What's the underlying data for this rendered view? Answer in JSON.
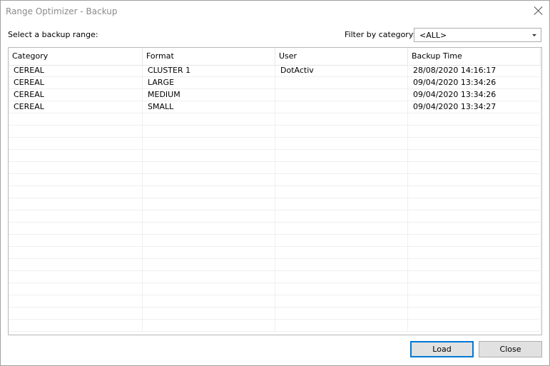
{
  "window": {
    "title": "Range Optimizer - Backup"
  },
  "form": {
    "select_label": "Select a backup range:",
    "filter_label": "Filter by category:",
    "filter_value": "<ALL>"
  },
  "table": {
    "columns": [
      "Category",
      "Format",
      "User",
      "Backup Time"
    ],
    "rows": [
      [
        "CEREAL",
        "CLUSTER 1",
        "DotActiv",
        "28/08/2020 14:16:17"
      ],
      [
        "CEREAL",
        "LARGE",
        "",
        "09/04/2020 13:34:26"
      ],
      [
        "CEREAL",
        "MEDIUM",
        "",
        "09/04/2020 13:34:26"
      ],
      [
        "CEREAL",
        "SMALL",
        "",
        "09/04/2020 13:34:27"
      ]
    ]
  },
  "buttons": {
    "load_label": "Load",
    "close_label": "Close"
  },
  "colors": {
    "accent": "#0078d7",
    "button_bg": "#e1e1e1",
    "title_text": "#8a8a8a"
  },
  "icons": {
    "close": "close-icon",
    "dropdown": "chevron-down-icon"
  }
}
